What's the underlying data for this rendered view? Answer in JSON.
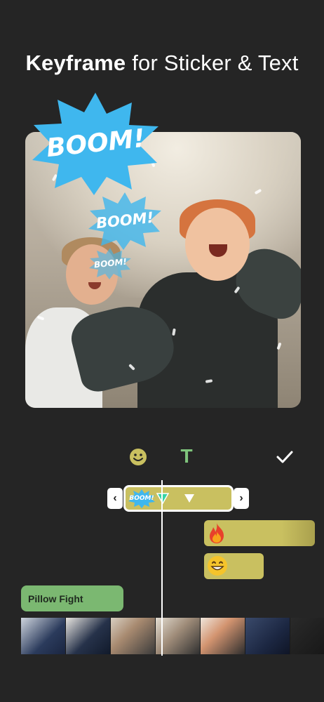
{
  "header": {
    "title_bold": "Keyframe",
    "title_rest": "for Sticker & Text"
  },
  "stickers": {
    "large": "BOOM!",
    "medium": "BOOM!",
    "small": "BOOM!"
  },
  "toolbar": {
    "emoji_icon": "smiley-icon",
    "text_icon_glyph": "T",
    "confirm_icon": "checkmark-icon"
  },
  "timeline": {
    "selected_sticker_thumb": "BOOM!",
    "left_handle": "‹",
    "right_handle": "›",
    "fire_track_icon": "fire-emoji-icon",
    "grin_track_icon": "grinning-emoji-icon",
    "text_track_label": "Pillow Fight"
  },
  "colors": {
    "background": "#252525",
    "track_yellow": "#c9c060",
    "track_green": "#7bb871",
    "sticker_blue": "#3fb7ee",
    "text_tool_green": "#7fc47c"
  }
}
